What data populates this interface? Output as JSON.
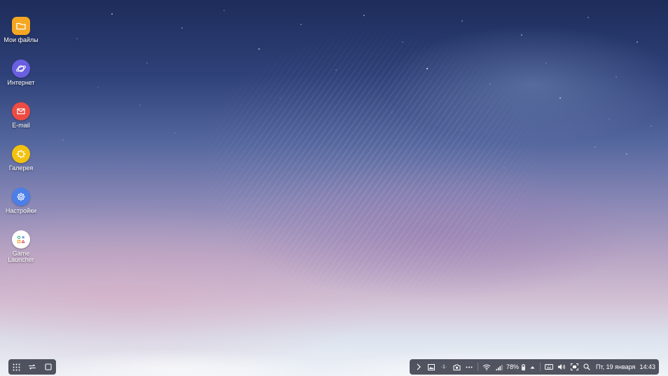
{
  "desktop": {
    "icons": [
      {
        "label": "Мои файлы",
        "icon": "folder-icon",
        "color": "#f5a623"
      },
      {
        "label": "Интернет",
        "icon": "planet-icon",
        "color": "#6a5fe0"
      },
      {
        "label": "E-mail",
        "icon": "envelope-icon",
        "color": "#ef4b45"
      },
      {
        "label": "Галерея",
        "icon": "flower-icon",
        "color": "#f2c20f"
      },
      {
        "label": "Настройки",
        "icon": "gear-icon",
        "color": "#4c7fe8"
      },
      {
        "label": "Game\nLauncher",
        "icon": "game-launcher-icon",
        "color": "#ffffff"
      }
    ]
  },
  "taskbar": {
    "left": [
      "apps-grid-icon",
      "recent-apps-icon",
      "home-square-icon"
    ],
    "right": {
      "icons": [
        "chevron-right-icon",
        "image-icon",
        "notification-count-icon",
        "camera-icon",
        "more-dots-icon",
        "wifi-icon",
        "signal-icon",
        "battery-icon",
        "caret-up-icon",
        "keyboard-icon",
        "volume-icon",
        "screenshot-icon",
        "search-icon"
      ],
      "notification_count": "·1·",
      "battery": "78%",
      "date": "Пт, 19 января",
      "time": "14:43"
    }
  }
}
